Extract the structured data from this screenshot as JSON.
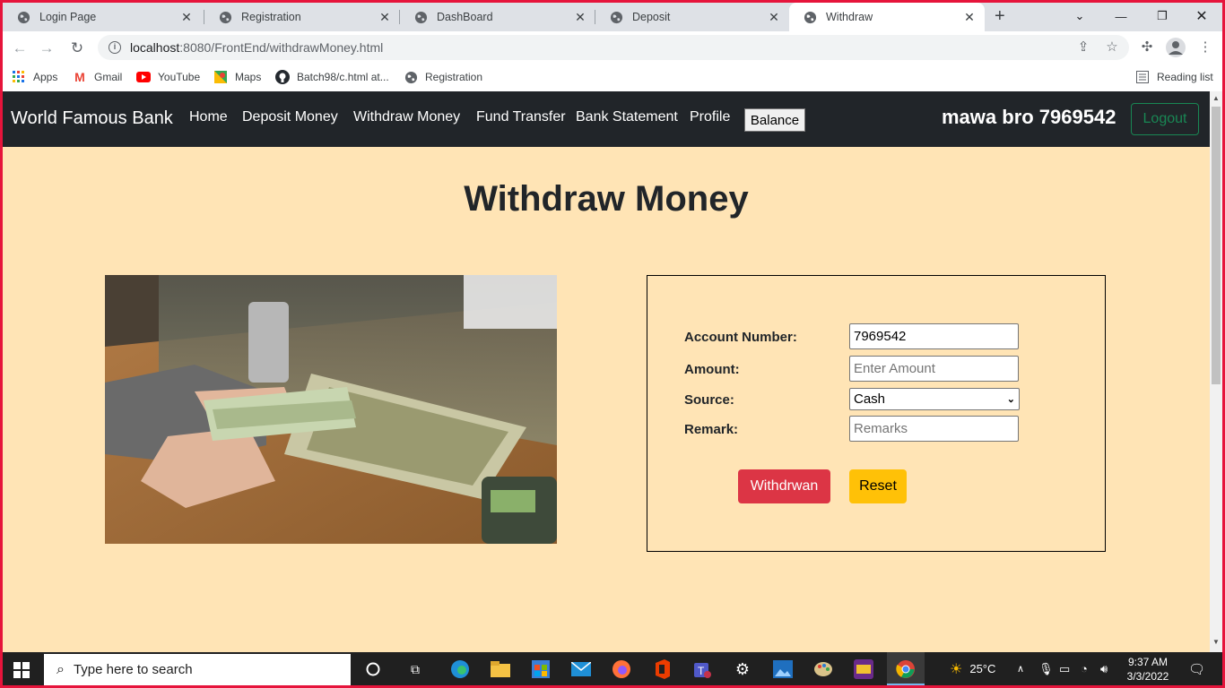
{
  "browser": {
    "tabs": [
      {
        "title": "Login Page",
        "active": false
      },
      {
        "title": "Registration",
        "active": false
      },
      {
        "title": "DashBoard",
        "active": false
      },
      {
        "title": "Deposit",
        "active": false
      },
      {
        "title": "Withdraw",
        "active": true
      }
    ],
    "url_host": "localhost",
    "url_rest": ":8080/FrontEnd/withdrawMoney.html",
    "bookmarks": [
      "Apps",
      "Gmail",
      "YouTube",
      "Maps",
      "Batch98/c.html at...",
      "Registration"
    ],
    "reading_list": "Reading list"
  },
  "app": {
    "brand": "World Famous Bank",
    "nav": [
      "Home",
      "Deposit Money",
      "Withdraw Money",
      "Fund Transfer",
      "Bank Statement",
      "Profile"
    ],
    "balance_button": "Balance",
    "user": "mawa bro 7969542",
    "logout_button": "Logout"
  },
  "page": {
    "title": "Withdraw Money",
    "form": {
      "account_label": "Account Number:",
      "account_value": "7969542",
      "amount_label": "Amount:",
      "amount_placeholder": "Enter Amount",
      "source_label": "Source:",
      "source_value": "Cash",
      "remark_label": "Remark:",
      "remark_placeholder": "Remarks",
      "submit_button": "Withdrwan",
      "reset_button": "Reset"
    }
  },
  "taskbar": {
    "search_placeholder": "Type here to search",
    "weather": "25°C",
    "time": "9:37 AM",
    "date": "3/3/2022"
  },
  "colors": {
    "page_bg": "#ffe4b5",
    "navbar_bg": "#212529",
    "danger": "#dc3545",
    "warning": "#ffc107",
    "success": "#198754",
    "screen_border": "#e6143b"
  }
}
